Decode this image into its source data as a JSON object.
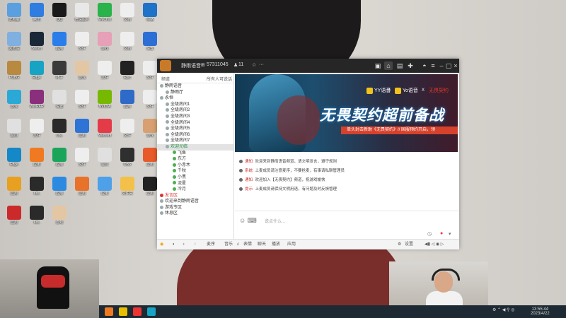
{
  "colors": {
    "accent": "#1e8ee6",
    "titlebar": "#262626",
    "brand_red": "#d6412c"
  },
  "desktop_icons": [
    {
      "label": "此电脑",
      "icon": "computer-icon",
      "color": "#5aa0e0"
    },
    {
      "label": "腾讯",
      "icon": "app-icon",
      "color": "#2f7de1"
    },
    {
      "label": "QQ",
      "icon": "qq-penguin-icon",
      "color": "#1a1a1a"
    },
    {
      "label": "微信图片",
      "icon": "image-icon",
      "color": "#e8e8e8"
    },
    {
      "label": "WeChat",
      "icon": "wechat-icon",
      "color": "#29b34a"
    },
    {
      "label": "文档",
      "icon": "file-icon",
      "color": "#eeeeee"
    },
    {
      "label": "网络",
      "icon": "globe-icon",
      "color": "#1e73c8"
    },
    {
      "label": "回收站",
      "icon": "recycle-bin-icon",
      "color": "#7fb0e0"
    },
    {
      "label": "Steam",
      "icon": "steam-icon",
      "color": "#1b2838"
    },
    {
      "label": "应用",
      "icon": "app-icon",
      "color": "#2b7de9"
    },
    {
      "label": "文件",
      "icon": "file-icon",
      "color": "#eeeeee"
    },
    {
      "label": "游戏",
      "icon": "game-icon",
      "color": "#e6a0b8"
    },
    {
      "label": "文档",
      "icon": "file-icon",
      "color": "#eeeeee"
    },
    {
      "label": "设置",
      "icon": "window-icon",
      "color": "#2b6fd6"
    },
    {
      "label": "PUBG",
      "icon": "game-icon",
      "color": "#b8893e"
    },
    {
      "label": "Edge",
      "icon": "edge-icon",
      "color": "#17a3c4"
    },
    {
      "label": "杯子",
      "icon": "mug-icon",
      "color": "#3a3a3a"
    },
    {
      "label": "游戏",
      "icon": "game-icon",
      "color": "#e3c7a4"
    },
    {
      "label": "文件",
      "icon": "file-icon",
      "color": "#eeeeee"
    },
    {
      "label": "Epic",
      "icon": "epic-icon",
      "color": "#222222"
    },
    {
      "label": "文件",
      "icon": "file-icon",
      "color": "#eeeeee"
    },
    {
      "label": "游戏",
      "icon": "game-icon",
      "color": "#2aa9d6"
    },
    {
      "label": "WinRAR",
      "icon": "archive-icon",
      "color": "#8a2f7c"
    },
    {
      "label": "设置",
      "icon": "window-icon",
      "color": "#e0e0e0"
    },
    {
      "label": "文件",
      "icon": "file-icon",
      "color": "#eeeeee"
    },
    {
      "label": "NVIDIA",
      "icon": "nvidia-icon",
      "color": "#76b900"
    },
    {
      "label": "应用",
      "icon": "app-icon",
      "color": "#2e6ac8"
    },
    {
      "label": "文件",
      "icon": "file-icon",
      "color": "#eeeeee"
    },
    {
      "label": "窗口",
      "icon": "window-icon",
      "color": "#e0e0e0"
    },
    {
      "label": "文件",
      "icon": "file-icon",
      "color": "#eeeeee"
    },
    {
      "label": "LoL",
      "icon": "lol-icon",
      "color": "#2a2a2a"
    },
    {
      "label": "应用",
      "icon": "app-icon",
      "color": "#2d74d6"
    },
    {
      "label": "Valorant",
      "icon": "valorant-icon",
      "color": "#e43b48"
    },
    {
      "label": "文件",
      "icon": "file-icon",
      "color": "#eeeeee"
    },
    {
      "label": "游戏",
      "icon": "game-icon",
      "color": "#d8a070"
    },
    {
      "label": "Edge",
      "icon": "edge-icon",
      "color": "#1588c7"
    },
    {
      "label": "应用",
      "icon": "app-icon",
      "color": "#f07a22"
    },
    {
      "label": "应用",
      "icon": "app-icon",
      "color": "#1aa55b"
    },
    {
      "label": "文件",
      "icon": "file-icon",
      "color": "#eeeeee"
    },
    {
      "label": "窗口",
      "icon": "window-icon",
      "color": "#e0e0e0"
    },
    {
      "label": "OBS",
      "icon": "obs-icon",
      "color": "#2f2f2f"
    },
    {
      "label": "应用",
      "icon": "app-icon",
      "color": "#e85a2a"
    },
    {
      "label": "应用",
      "icon": "app-icon",
      "color": "#e8a020"
    },
    {
      "label": "LoL",
      "icon": "lol-icon",
      "color": "#2a2a2a"
    },
    {
      "label": "应用",
      "icon": "app-icon",
      "color": "#2c8be0"
    },
    {
      "label": "应用",
      "icon": "app-icon",
      "color": "#e8722a"
    },
    {
      "label": "应用",
      "icon": "app-icon",
      "color": "#4ea0e8"
    },
    {
      "label": "文件夹",
      "icon": "folder-icon",
      "color": "#f3c04a"
    },
    {
      "label": "应用",
      "icon": "app-icon",
      "color": "#222222"
    },
    {
      "label": "应用",
      "icon": "app-icon",
      "color": "#cc2a2a"
    },
    {
      "label": "LoL",
      "icon": "lol-icon",
      "color": "#2a2a2a"
    },
    {
      "label": "游戏",
      "icon": "game-icon",
      "color": "#e3c7a4"
    }
  ],
  "window": {
    "title_name": "静雨语音",
    "title_id": "57311045",
    "title_count": "11",
    "sidebar_header_left": "频道",
    "sidebar_header_right": "所有人可说话",
    "tree": [
      {
        "label": "静雨语音",
        "type": "group",
        "color": "#333"
      },
      {
        "label": "静雨厅",
        "type": "sub",
        "color": "#333"
      },
      {
        "label": "永恒",
        "type": "group",
        "color": "#333"
      },
      {
        "label": "全级房间1",
        "type": "item",
        "color": "#333"
      },
      {
        "label": "全级房间2",
        "type": "item",
        "color": "#333"
      },
      {
        "label": "全级房间3",
        "type": "item",
        "color": "#333"
      },
      {
        "label": "全级房间4",
        "type": "item",
        "color": "#333"
      },
      {
        "label": "全级房间5",
        "type": "item",
        "color": "#333"
      },
      {
        "label": "全级房间6",
        "type": "item",
        "color": "#333"
      },
      {
        "label": "全级房间7",
        "type": "item",
        "color": "#333"
      },
      {
        "label": "欢迎光临",
        "type": "selected",
        "color": "#1a8a3a"
      },
      {
        "label": "飞鱼",
        "type": "user",
        "color": "#333"
      },
      {
        "label": "东方",
        "type": "user",
        "color": "#333"
      },
      {
        "label": "小赤木",
        "type": "user",
        "color": "#333"
      },
      {
        "label": "千秋",
        "type": "user",
        "color": "#333"
      },
      {
        "label": "小黑",
        "type": "user",
        "color": "#333"
      },
      {
        "label": "流星",
        "type": "user",
        "color": "#333"
      },
      {
        "label": "冷月",
        "type": "user",
        "color": "#333"
      },
      {
        "label": "发言区",
        "type": "red",
        "color": "#d33"
      },
      {
        "label": "欢迎来到静雨语音",
        "type": "group",
        "color": "#333"
      },
      {
        "label": "游戏专区",
        "type": "group",
        "color": "#333"
      },
      {
        "label": "休息区",
        "type": "group",
        "color": "#333"
      }
    ],
    "banner_badge_yy": "YY语音",
    "banner_badge_yo": "Yo语音",
    "banner_badge_last": "无畏契约",
    "banner_title": "无畏契约超前备战",
    "banner_strip": "单头封击新助《无畏契约》// 国服预约开启，领",
    "chat": [
      {
        "prefix": "通知:",
        "text": "欢迎来到静雨语音频道，请文明发言，遵守规则"
      },
      {
        "prefix": "系统:",
        "text": "上麦成员请注意麦序，不要抢麦，有事请私聊管理员"
      },
      {
        "prefix": "通知:",
        "text": "欢迎加入【无畏契约】频道，祝游戏愉快"
      },
      {
        "prefix": "提示:",
        "text": "上麦成员请保持文明用语，有问题及时反馈管理"
      }
    ],
    "input_placeholder": "说点什么...",
    "bottom_items": [
      "麦序",
      "音乐",
      "表情",
      "聊天",
      "播放",
      "应用"
    ],
    "bottom_right": "设置"
  },
  "tray": {
    "time": "13:55:44",
    "date": "2023/4/22"
  }
}
